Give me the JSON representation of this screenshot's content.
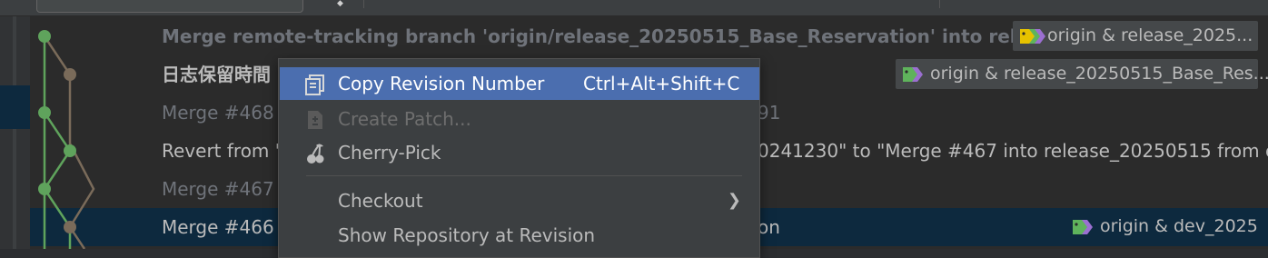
{
  "toolbar": {},
  "commits": [
    {
      "message": "Merge remote-tracking branch 'origin/release_20250515_Base_Reservation' into release_2",
      "ref": "origin & release_2025..."
    },
    {
      "message": "日志保留時間",
      "ref": "origin & release_20250515_Base_Res..."
    },
    {
      "message": "Merge #468",
      "tail": "91"
    },
    {
      "message": "Revert from \"",
      "tail": "0241230\" to \"Merge #467 into release_20250515 from c"
    },
    {
      "message": "Merge #467"
    },
    {
      "message": "Merge #466",
      "tail": "on",
      "ref": "origin & dev_2025"
    }
  ],
  "context_menu": {
    "items": [
      {
        "label": "Copy Revision Number",
        "shortcut": "Ctrl+Alt+Shift+C",
        "icon": "copy-icon"
      },
      {
        "label": "Create Patch...",
        "icon": "patch-icon"
      },
      {
        "label": "Cherry-Pick",
        "icon": "cherry-icon"
      },
      {
        "label": "Checkout",
        "icon": "chevron-right-icon"
      },
      {
        "label": "Show Repository at Revision"
      }
    ]
  },
  "colors": {
    "accent_selected_menu": "#4b6eaf",
    "selected_row": "#0d293e",
    "graph_green": "#5fa35c",
    "graph_brown": "#7a6b5a",
    "tag_yellow": "#e6c200",
    "tag_green": "#5fb35c",
    "tag_purple": "#9b6fd1"
  }
}
